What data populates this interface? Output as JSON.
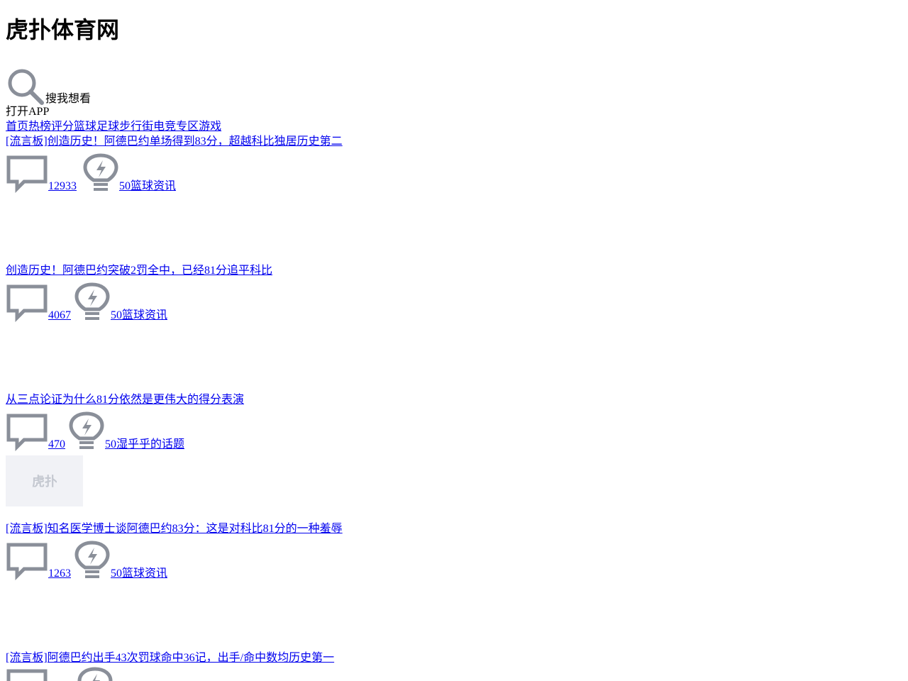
{
  "site": {
    "title": "虎扑体育网"
  },
  "search": {
    "placeholder_text": "搜我想看"
  },
  "app": {
    "open_label": "打开APP"
  },
  "nav": {
    "items": [
      "首页",
      "热榜",
      "评分",
      "篮球",
      "足球",
      "步行街",
      "电竞专区",
      "游戏"
    ]
  },
  "icons": {
    "search": "search-icon",
    "comment": "comment-icon",
    "light": "lightbulb-icon",
    "thumb_logo": "hupu-logo"
  },
  "colors": {
    "link": "#0000ee",
    "icon_gray": "#8a8f99",
    "thumb_bg": "#f1f2f6"
  },
  "posts": [
    {
      "title": "[流言板]创造历史！阿德巴约单场得到83分，超越科比独居历史第二",
      "comments": "12933",
      "light_board": "50篮球资讯"
    },
    {
      "title": "创造历史！阿德巴约突破2罚全中，已经81分追平科比",
      "comments": "4067",
      "light_board": "50篮球资讯"
    },
    {
      "title": "从三点论证为什么81分依然是更伟大的得分表演",
      "comments": "470",
      "light_board": "50湿乎乎的话题"
    },
    {
      "title": "[流言板]知名医学博士谈阿德巴约83分：这是对科比81分的一种羞辱",
      "comments": "1263",
      "light_board": "50篮球资讯"
    },
    {
      "title": "[流言板]阿德巴约出手43次罚球命中36记，出手/命中数均历史第一"
    }
  ]
}
